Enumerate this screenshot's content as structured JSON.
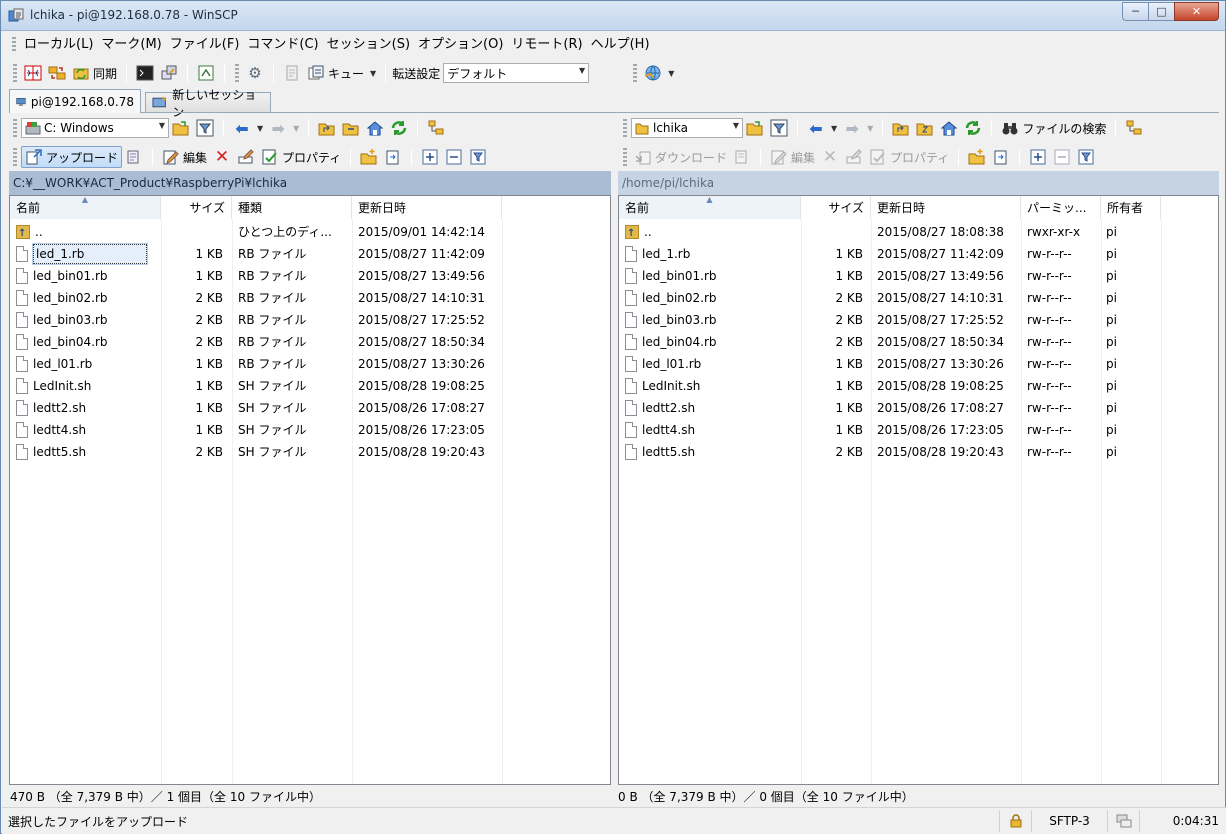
{
  "window": {
    "title": "lchika - pi@192.168.0.78 - WinSCP",
    "controls": [
      "─",
      "□",
      "✕"
    ]
  },
  "menu": [
    "ローカル(L)",
    "マーク(M)",
    "ファイル(F)",
    "コマンド(C)",
    "セッション(S)",
    "オプション(O)",
    "リモート(R)",
    "ヘルプ(H)"
  ],
  "toolbar": {
    "sync_label": "同期",
    "queue_label": "キュー",
    "transfer_label": "転送設定",
    "transfer_value": "デフォルト"
  },
  "tabs": {
    "active": "pi@192.168.0.78",
    "new_session": "新しいセッション"
  },
  "local": {
    "drive": "C: Windows",
    "upload_label": "アップロード",
    "edit_label": "編集",
    "properties_label": "プロパティ",
    "path": "C:¥__WORK¥ACT_Product¥RaspberryPi¥lchika",
    "columns": {
      "name": "名前",
      "size": "サイズ",
      "type": "種類",
      "modified": "更新日時"
    },
    "files": [
      {
        "name": "..",
        "size": "",
        "type": "ひとつ上のディ...",
        "modified": "2015/09/01  14:42:14"
      },
      {
        "name": "led_1.rb",
        "size": "1 KB",
        "type": "RB ファイル",
        "modified": "2015/08/27  11:42:09"
      },
      {
        "name": "led_bin01.rb",
        "size": "1 KB",
        "type": "RB ファイル",
        "modified": "2015/08/27  13:49:56"
      },
      {
        "name": "led_bin02.rb",
        "size": "2 KB",
        "type": "RB ファイル",
        "modified": "2015/08/27  14:10:31"
      },
      {
        "name": "led_bin03.rb",
        "size": "2 KB",
        "type": "RB ファイル",
        "modified": "2015/08/27  17:25:52"
      },
      {
        "name": "led_bin04.rb",
        "size": "2 KB",
        "type": "RB ファイル",
        "modified": "2015/08/27  18:50:34"
      },
      {
        "name": "led_l01.rb",
        "size": "1 KB",
        "type": "RB ファイル",
        "modified": "2015/08/27  13:30:26"
      },
      {
        "name": "LedInit.sh",
        "size": "1 KB",
        "type": "SH ファイル",
        "modified": "2015/08/28  19:08:25"
      },
      {
        "name": "ledtt2.sh",
        "size": "1 KB",
        "type": "SH ファイル",
        "modified": "2015/08/26  17:08:27"
      },
      {
        "name": "ledtt4.sh",
        "size": "1 KB",
        "type": "SH ファイル",
        "modified": "2015/08/26  17:23:05"
      },
      {
        "name": "ledtt5.sh",
        "size": "2 KB",
        "type": "SH ファイル",
        "modified": "2015/08/28  19:20:43"
      }
    ],
    "status": "470 B （全 7,379 B 中）／ 1 個目（全 10 ファイル中）"
  },
  "remote": {
    "dir": "lchika",
    "find_label": "ファイルの検索",
    "download_label": "ダウンロード",
    "edit_label": "編集",
    "properties_label": "プロパティ",
    "path": "/home/pi/lchika",
    "columns": {
      "name": "名前",
      "size": "サイズ",
      "modified": "更新日時",
      "perms": "パーミッ...",
      "owner": "所有者"
    },
    "files": [
      {
        "name": "..",
        "size": "",
        "modified": "2015/08/27 18:08:38",
        "perms": "rwxr-xr-x",
        "owner": "pi"
      },
      {
        "name": "led_1.rb",
        "size": "1 KB",
        "modified": "2015/08/27 11:42:09",
        "perms": "rw-r--r--",
        "owner": "pi"
      },
      {
        "name": "led_bin01.rb",
        "size": "1 KB",
        "modified": "2015/08/27 13:49:56",
        "perms": "rw-r--r--",
        "owner": "pi"
      },
      {
        "name": "led_bin02.rb",
        "size": "2 KB",
        "modified": "2015/08/27 14:10:31",
        "perms": "rw-r--r--",
        "owner": "pi"
      },
      {
        "name": "led_bin03.rb",
        "size": "2 KB",
        "modified": "2015/08/27 17:25:52",
        "perms": "rw-r--r--",
        "owner": "pi"
      },
      {
        "name": "led_bin04.rb",
        "size": "2 KB",
        "modified": "2015/08/27 18:50:34",
        "perms": "rw-r--r--",
        "owner": "pi"
      },
      {
        "name": "led_l01.rb",
        "size": "1 KB",
        "modified": "2015/08/27 13:30:26",
        "perms": "rw-r--r--",
        "owner": "pi"
      },
      {
        "name": "LedInit.sh",
        "size": "1 KB",
        "modified": "2015/08/28 19:08:25",
        "perms": "rw-r--r--",
        "owner": "pi"
      },
      {
        "name": "ledtt2.sh",
        "size": "1 KB",
        "modified": "2015/08/26 17:08:27",
        "perms": "rw-r--r--",
        "owner": "pi"
      },
      {
        "name": "ledtt4.sh",
        "size": "1 KB",
        "modified": "2015/08/26 17:23:05",
        "perms": "rw-r--r--",
        "owner": "pi"
      },
      {
        "name": "ledtt5.sh",
        "size": "2 KB",
        "modified": "2015/08/28 19:20:43",
        "perms": "rw-r--r--",
        "owner": "pi"
      }
    ],
    "status": "0 B （全 7,379 B 中）／ 0 個目（全 10 ファイル中）"
  },
  "statusbar": {
    "hint": "選択したファイルをアップロード",
    "protocol": "SFTP-3",
    "elapsed": "0:04:31"
  }
}
